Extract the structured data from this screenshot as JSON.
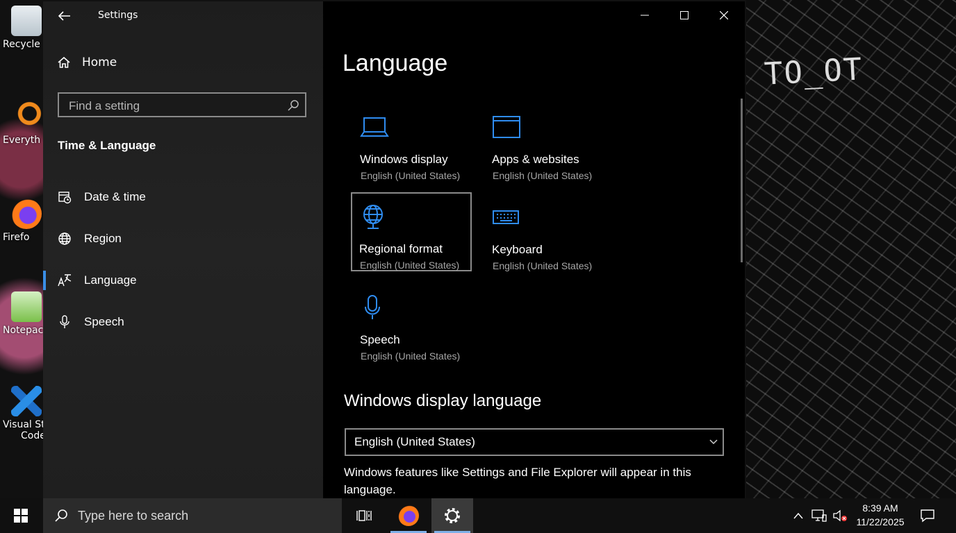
{
  "desktop": {
    "icons": [
      {
        "label": "Recycle",
        "icon": "recycle-bin-icon"
      },
      {
        "label": "Everyth",
        "icon": "everything-search-icon"
      },
      {
        "label": "Firefo",
        "icon": "firefox-icon"
      },
      {
        "label": "Notepac",
        "icon": "notepad-icon"
      },
      {
        "label": "Visual St",
        "label2": "Code",
        "icon": "vscode-icon"
      }
    ],
    "wallpaper_text": "TO_OT"
  },
  "window": {
    "title": "Settings",
    "controls": [
      "minimize",
      "maximize",
      "close"
    ]
  },
  "sidebar": {
    "home_label": "Home",
    "search_placeholder": "Find a setting",
    "section_title": "Time & Language",
    "items": [
      {
        "label": "Date & time",
        "icon": "calendar-clock-icon"
      },
      {
        "label": "Region",
        "icon": "globe-icon"
      },
      {
        "label": "Language",
        "icon": "language-icon",
        "active": true
      },
      {
        "label": "Speech",
        "icon": "microphone-icon"
      }
    ]
  },
  "main": {
    "title": "Language",
    "tiles": [
      {
        "name": "Windows display",
        "sub": "English (United States)",
        "icon": "laptop-icon"
      },
      {
        "name": "Apps & websites",
        "sub": "English (United States)",
        "icon": "window-icon"
      },
      {
        "name": "Regional format",
        "sub": "English (United States)",
        "icon": "globe-icon",
        "selected": true
      },
      {
        "name": "Keyboard",
        "sub": "English (United States)",
        "icon": "keyboard-icon"
      },
      {
        "name": "Speech",
        "sub": "English (United States)",
        "icon": "microphone-icon"
      }
    ],
    "display_language_heading": "Windows display language",
    "display_language_value": "English (United States)",
    "display_language_desc": "Windows features like Settings and File Explorer will appear in this language."
  },
  "taskbar": {
    "search_placeholder": "Type here to search",
    "time": "8:39 AM",
    "date": "11/22/2025"
  },
  "colors": {
    "accent": "#3a8ee6",
    "icon_blue": "#2f8cf0"
  }
}
